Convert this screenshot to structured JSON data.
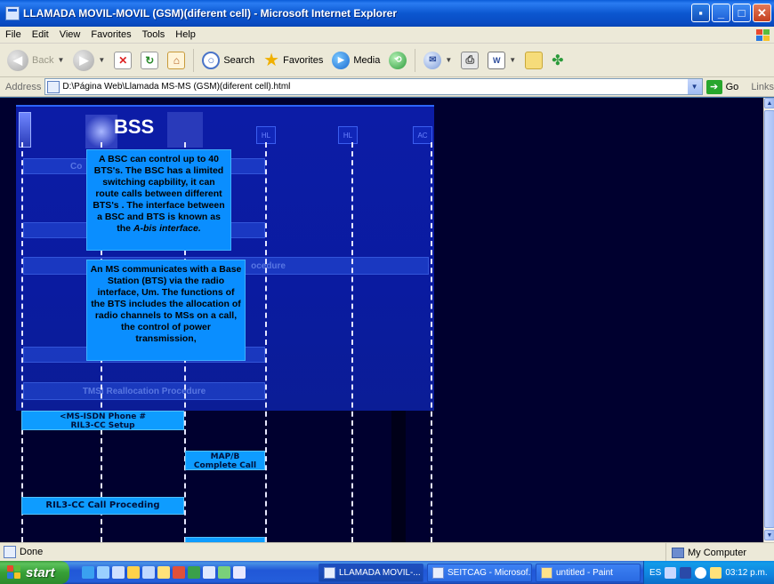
{
  "window": {
    "title": "LLAMADA MOVIL-MOVIL (GSM)(diferent cell) - Microsoft Internet Explorer"
  },
  "menu": [
    "File",
    "Edit",
    "View",
    "Favorites",
    "Tools",
    "Help"
  ],
  "toolbar": {
    "back": "Back",
    "search": "Search",
    "favorites": "Favorites",
    "media": "Media"
  },
  "address": {
    "label": "Address",
    "value": "D:\\Página Web\\Llamada MS-MS (GSM)(diferent cell).html",
    "go": "Go",
    "links": "Links"
  },
  "page": {
    "bss_title": "BSS",
    "info_bsc": {
      "text": "A BSC can control up to 40 BTS's. The BSC has a limited switching capbility, it can route calls between different BTS's . The interface between a  BSC and BTS is known as the",
      "italic": "A-bis interface."
    },
    "info_ms": "An MS communicates with a Base Station (BTS) via the radio interface, Um. The functions of the BTS includes the allocation of radio channels to MSs on a call, the control of power transmission,",
    "bands": {
      "procedure": "ocedure",
      "tmsi": "TMSI Reallocation Procedure",
      "co": "Co"
    },
    "messages": {
      "setup_line1": "<MS-ISDN Phone #",
      "setup_line2": "RIL3-CC Setup",
      "map_line1": "MAP/B",
      "map_line2": "Complete Call",
      "proceeding": "RIL3-CC Call Proceding"
    }
  },
  "status": {
    "text": "Done",
    "zone": "My Computer"
  },
  "taskbar": {
    "start": "start",
    "tasks": [
      "LLAMADA MOVIL-...",
      "SEITCAG - Microsof...",
      "untitled - Paint"
    ],
    "lang": "ES",
    "clock": "03:12 p.m."
  }
}
